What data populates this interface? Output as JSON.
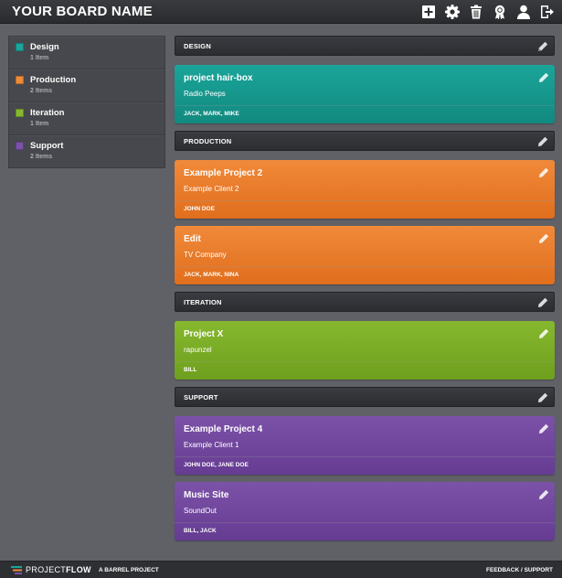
{
  "header": {
    "board_title": "YOUR BOARD NAME",
    "icons": [
      "add-icon",
      "gear-icon",
      "trash-icon",
      "award-icon",
      "user-icon",
      "logout-icon"
    ]
  },
  "sidebar": {
    "items": [
      {
        "label": "Design",
        "count": "1 Item",
        "color": "#1aa59a"
      },
      {
        "label": "Production",
        "count": "2 Items",
        "color": "#f08a3a"
      },
      {
        "label": "Iteration",
        "count": "1 Item",
        "color": "#86b82e"
      },
      {
        "label": "Support",
        "count": "2 Items",
        "color": "#7b52a8"
      }
    ]
  },
  "sections": [
    {
      "title": "DESIGN",
      "color": "#1aa59a",
      "cards": [
        {
          "title": "project hair-box",
          "client": "Radio Peeps",
          "people": "JACK, MARK, MIKE"
        }
      ]
    },
    {
      "title": "PRODUCTION",
      "color": "#f08a3a",
      "cards": [
        {
          "title": "Example Project 2",
          "client": "Example Client 2",
          "people": "JOHN DOE"
        },
        {
          "title": "Edit",
          "client": "TV Company",
          "people": "JACK, MARK, NINA"
        }
      ]
    },
    {
      "title": "ITERATION",
      "color": "#86b82e",
      "cards": [
        {
          "title": "Project X",
          "client": "rapunzel",
          "people": "BILL"
        }
      ]
    },
    {
      "title": "SUPPORT",
      "color": "#7b52a8",
      "cards": [
        {
          "title": "Example Project 4",
          "client": "Example Client 1",
          "people": "JOHN DOE, JANE DOE"
        },
        {
          "title": "Music Site",
          "client": "SoundOut",
          "people": "BILL, JACK"
        }
      ]
    }
  ],
  "footer": {
    "brand_light": "PROJECT",
    "brand_bold": "FLOW",
    "tagline": "A BARREL PROJECT",
    "feedback": "FEEDBACK",
    "separator": " / ",
    "support": "SUPPORT"
  }
}
